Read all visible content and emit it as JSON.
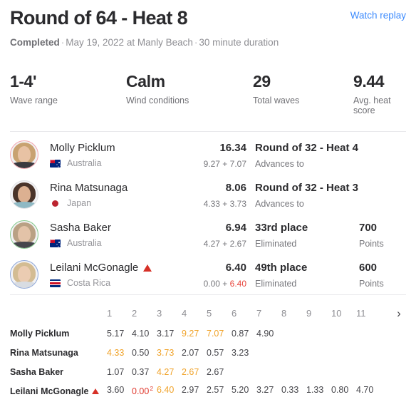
{
  "header": {
    "title": "Round of 64 - Heat 8",
    "status": "Completed",
    "meta": "May 19, 2022 at Manly Beach",
    "duration": "30 minute duration",
    "watch_replay": "Watch replay",
    "separator": "·"
  },
  "stats": [
    {
      "value": "1-4'",
      "label": "Wave range"
    },
    {
      "value": "Calm",
      "label": "Wind conditions"
    },
    {
      "value": "29",
      "label": "Total waves"
    },
    {
      "value": "9.44",
      "label": "Avg. heat score"
    }
  ],
  "athletes": [
    {
      "name": "Molly Picklum",
      "country": "Australia",
      "flag": "flag-australia-icon",
      "ring": "pink",
      "total": "16.34",
      "parts_a": "9.27",
      "parts_op": "+",
      "parts_b": "7.07",
      "parts_b_highlight": false,
      "result": "Round of 32 - Heat 4",
      "result_sub": "Advances to",
      "points": "",
      "points_label": "",
      "priority_flag": false
    },
    {
      "name": "Rina Matsunaga",
      "country": "Japan",
      "flag": "flag-japan-icon",
      "ring": "white",
      "total": "8.06",
      "parts_a": "4.33",
      "parts_op": "+",
      "parts_b": "3.73",
      "parts_b_highlight": false,
      "result": "Round of 32 - Heat 3",
      "result_sub": "Advances to",
      "points": "",
      "points_label": "",
      "priority_flag": false
    },
    {
      "name": "Sasha Baker",
      "country": "Australia",
      "flag": "flag-australia-icon",
      "ring": "green",
      "total": "6.94",
      "parts_a": "4.27",
      "parts_op": "+",
      "parts_b": "2.67",
      "parts_b_highlight": false,
      "result": "33rd place",
      "result_sub": "Eliminated",
      "points": "700",
      "points_label": "Points",
      "priority_flag": false
    },
    {
      "name": "Leilani McGonagle",
      "country": "Costa Rica",
      "flag": "flag-costarica-icon",
      "ring": "blue",
      "total": "6.40",
      "parts_a": "0.00",
      "parts_op": "+",
      "parts_b": "6.40",
      "parts_b_highlight": true,
      "result": "49th place",
      "result_sub": "Eliminated",
      "points": "600",
      "points_label": "Points",
      "priority_flag": true
    }
  ],
  "wave_table": {
    "columns": [
      "1",
      "2",
      "3",
      "4",
      "5",
      "6",
      "7",
      "8",
      "9",
      "10",
      "11"
    ],
    "next_icon": "chevron-right-icon",
    "rows": [
      {
        "name": "Molly Picklum",
        "priority_flag": false,
        "scores": [
          {
            "v": "5.17",
            "style": ""
          },
          {
            "v": "4.10",
            "style": ""
          },
          {
            "v": "3.17",
            "style": ""
          },
          {
            "v": "9.27",
            "style": "orange"
          },
          {
            "v": "7.07",
            "style": "orange"
          },
          {
            "v": "0.87",
            "style": ""
          },
          {
            "v": "4.90",
            "style": ""
          }
        ]
      },
      {
        "name": "Rina Matsunaga",
        "priority_flag": false,
        "scores": [
          {
            "v": "4.33",
            "style": "orange"
          },
          {
            "v": "0.50",
            "style": ""
          },
          {
            "v": "3.73",
            "style": "orange"
          },
          {
            "v": "2.07",
            "style": ""
          },
          {
            "v": "0.57",
            "style": ""
          },
          {
            "v": "3.23",
            "style": ""
          }
        ]
      },
      {
        "name": "Sasha Baker",
        "priority_flag": false,
        "scores": [
          {
            "v": "1.07",
            "style": ""
          },
          {
            "v": "0.37",
            "style": ""
          },
          {
            "v": "4.27",
            "style": "orange"
          },
          {
            "v": "2.67",
            "style": "orange"
          },
          {
            "v": "2.67",
            "style": ""
          }
        ]
      },
      {
        "name": "Leilani McGonagle",
        "priority_flag": true,
        "scores": [
          {
            "v": "3.60",
            "style": ""
          },
          {
            "v": "0.00",
            "style": "red",
            "sup": "2"
          },
          {
            "v": "6.40",
            "style": "orange"
          },
          {
            "v": "2.97",
            "style": ""
          },
          {
            "v": "2.57",
            "style": ""
          },
          {
            "v": "5.20",
            "style": ""
          },
          {
            "v": "3.27",
            "style": ""
          },
          {
            "v": "0.33",
            "style": ""
          },
          {
            "v": "1.33",
            "style": ""
          },
          {
            "v": "0.80",
            "style": ""
          },
          {
            "v": "4.70",
            "style": ""
          }
        ]
      }
    ]
  },
  "colors": {
    "link": "#3d8bfd",
    "orange": "#f0a32a",
    "red": "#e03a2f",
    "text": "#2b2b2e",
    "muted": "#8e8e93"
  }
}
